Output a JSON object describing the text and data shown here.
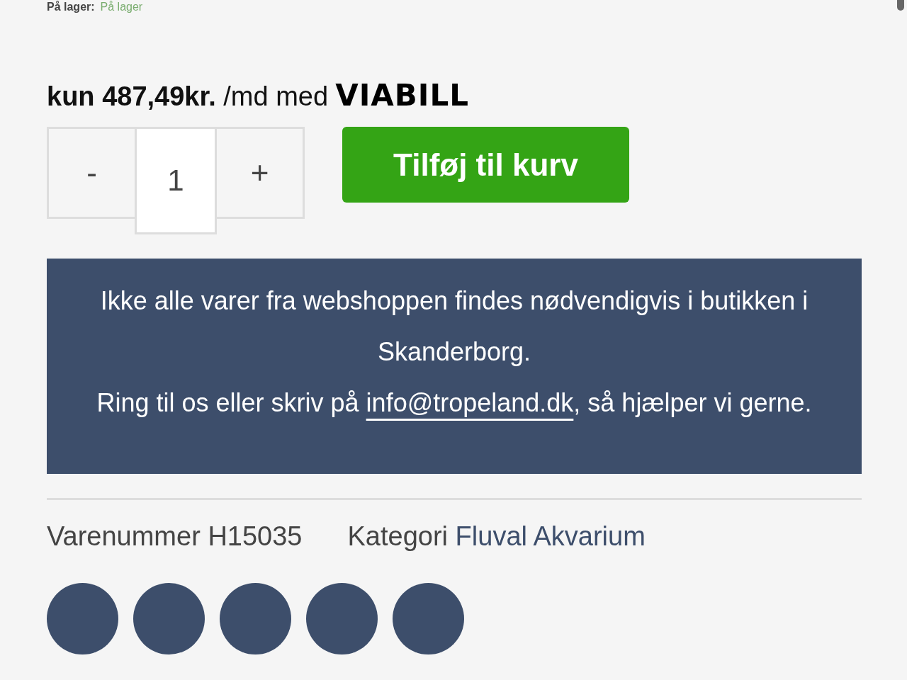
{
  "stock": {
    "label": "På lager:",
    "value": "På lager"
  },
  "financing": {
    "prefix": "kun",
    "amount": "487,49kr.",
    "suffix": "/md med",
    "provider": "VIABILL"
  },
  "quantity": {
    "minus": "-",
    "value": "1",
    "plus": "+"
  },
  "add_to_cart": "Tilføj til kurv",
  "notice": {
    "line1": "Ikke alle varer fra webshoppen findes nødvendigvis i butikken i Skanderborg.",
    "line2_before": "Ring til os eller skriv på",
    "link": "info@tropeland.dk",
    "line2_after": ", så hjælper vi gerne."
  },
  "meta": {
    "sku_label": "Varenummer",
    "sku": "H15035",
    "category_label": "Kategori",
    "category": "Fluval Akvarium"
  },
  "share_buttons": [
    {
      "kind": "circle"
    },
    {
      "kind": "circle"
    },
    {
      "kind": "circle"
    },
    {
      "kind": "circle"
    },
    {
      "kind": "circle"
    }
  ]
}
